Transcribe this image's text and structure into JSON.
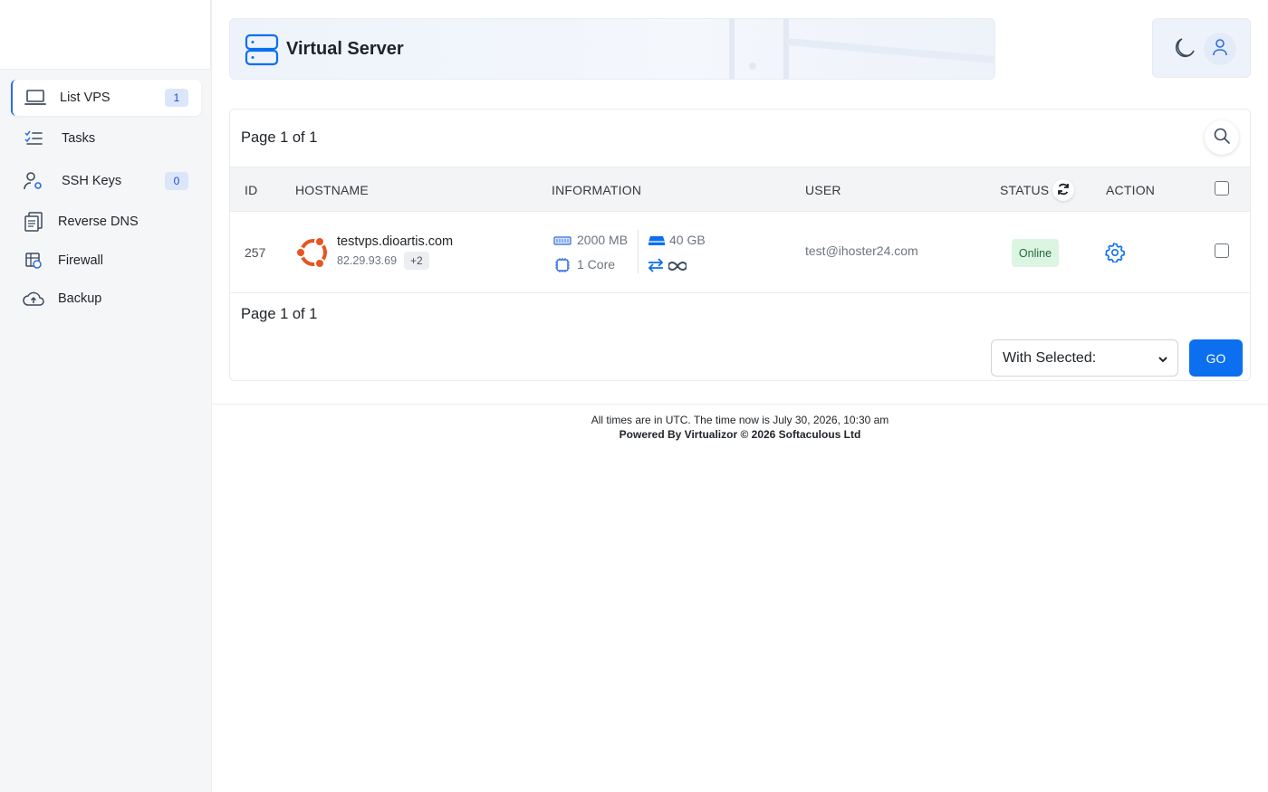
{
  "sidebar": {
    "items": [
      {
        "label": "List VPS",
        "badge": "1",
        "icon": "laptop-icon",
        "active": true
      },
      {
        "label": "Tasks",
        "icon": "task-list-icon"
      },
      {
        "label": "SSH Keys",
        "badge": "0",
        "icon": "key-user-icon"
      },
      {
        "label": "Reverse DNS",
        "icon": "dns-icon"
      },
      {
        "label": "Firewall",
        "icon": "firewall-icon"
      },
      {
        "label": "Backup",
        "icon": "cloud-upload-icon"
      }
    ]
  },
  "header": {
    "title": "Virtual Server",
    "icon": "server-icon"
  },
  "top_right": {
    "theme_icon": "moon-icon",
    "user_icon": "user-icon"
  },
  "pagination": {
    "top": "Page 1 of 1",
    "bottom": "Page 1 of 1"
  },
  "table": {
    "columns": [
      "ID",
      "HOSTNAME",
      "INFORMATION",
      "USER",
      "STATUS",
      "ACTION"
    ],
    "rows": [
      {
        "id": "257",
        "os_icon": "ubuntu-icon",
        "hostname": "testvps.dioartis.com",
        "ip": "82.29.93.69",
        "extra_ips": "+2",
        "ram": "2000 MB",
        "cpu": "1 Core",
        "disk": "40 GB",
        "bandwidth_icon": "infinity-icon",
        "user": "test@ihoster24.com",
        "status": "Online"
      }
    ]
  },
  "bulk": {
    "select_value": "With Selected:",
    "go_label": "GO"
  },
  "footer": {
    "time_text": "All times are in UTC. The time now is July 30, 2026, 10:30 am",
    "powered": "Powered By Virtualizor © 2026 Softaculous Ltd"
  },
  "colors": {
    "accent": "#0b6ff0",
    "ubuntu": "#e95420",
    "online_bg": "#dcf5e3"
  }
}
